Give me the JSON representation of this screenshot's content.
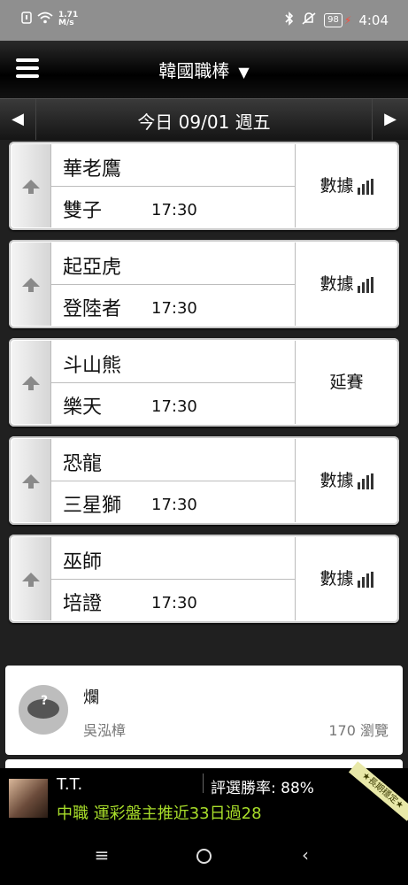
{
  "status_bar": {
    "speed": "1.71",
    "speed_unit": "M/s",
    "battery": "98",
    "time": "4:04"
  },
  "header": {
    "title": "韓國職棒",
    "dropdown_caret": "▼"
  },
  "date_bar": {
    "prev_arrow": "◀",
    "label": "今日 09/01 週五",
    "next_arrow": "▶"
  },
  "games": [
    {
      "away": "華老鷹",
      "home": "雙子",
      "time": "17:30",
      "action": "數據"
    },
    {
      "away": "起亞虎",
      "home": "登陸者",
      "time": "17:30",
      "action": "數據"
    },
    {
      "away": "斗山熊",
      "home": "樂天",
      "time": "17:30",
      "action": "延賽"
    },
    {
      "away": "恐龍",
      "home": "三星獅",
      "time": "17:30",
      "action": "數據"
    },
    {
      "away": "巫師",
      "home": "培證",
      "time": "17:30",
      "action": "數據"
    }
  ],
  "article": {
    "title": "爛",
    "author": "吳泓樟",
    "views": "170 瀏覽"
  },
  "banner": {
    "name": "T.T.",
    "rate_label": "評選勝率: 88%",
    "promo": "中職 運彩盤主推近33日過28",
    "ribbon": "★長期穩定★"
  },
  "colors": {
    "promo_text": "#a8dd2a",
    "status_bar": "#8f8f8f",
    "header": "#000000"
  }
}
